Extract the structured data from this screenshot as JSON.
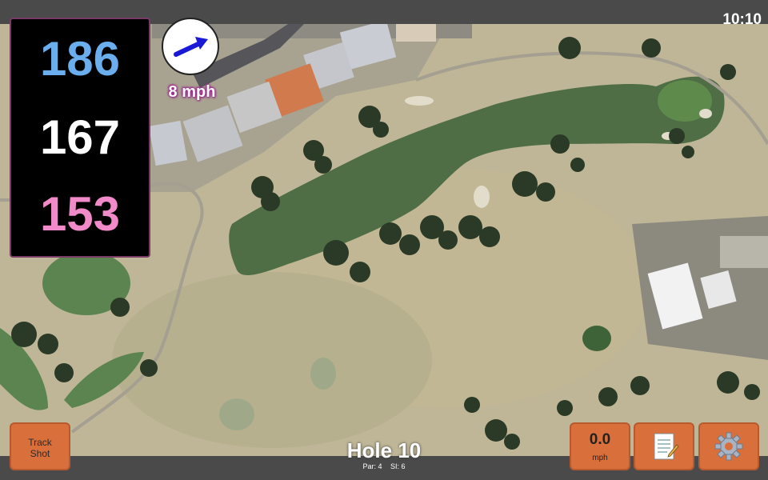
{
  "status_bar": {
    "time": "10:10"
  },
  "distances": {
    "back": "186",
    "middle": "167",
    "front": "153"
  },
  "wind": {
    "speed": "8 mph",
    "icon": "wind-arrow-icon"
  },
  "hole": {
    "title": "Hole 10",
    "par": "Par: 4",
    "si": "SI: 6"
  },
  "buttons": {
    "track_line1": "Track",
    "track_line2": "Shot",
    "speed_value": "0.0",
    "speed_unit": "mph",
    "notes_icon": "notepad-icon",
    "settings_icon": "gear-icon"
  },
  "colors": {
    "back": "#6aaeee",
    "middle": "#ffffff",
    "front": "#f08ac8",
    "button": "#d9703c"
  }
}
